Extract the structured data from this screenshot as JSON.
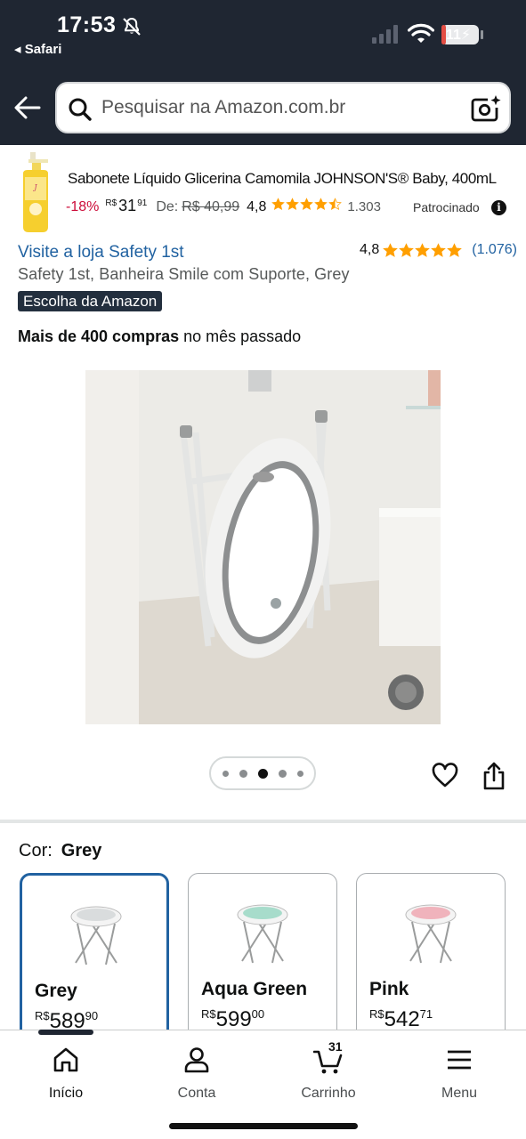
{
  "status_bar": {
    "time": "17:53",
    "back_app": "◂ Safari",
    "battery": "11",
    "battery_level": 0.11,
    "icons": [
      "bell-slash-icon",
      "cellular-signal-icon",
      "wifi-icon",
      "battery-icon"
    ]
  },
  "header": {
    "search_placeholder": "Pesquisar na Amazon.com.br",
    "icons": [
      "back-arrow-icon",
      "search-icon",
      "camera-search-icon"
    ]
  },
  "sponsored_ad": {
    "title": "Sabonete Líquido Glicerina Camomila JOHNSON'S® Baby, 400mL",
    "discount": "-18%",
    "currency": "R$",
    "price_whole": "31",
    "price_cents": "91",
    "old_label": "De:",
    "old_price": "R$ 40,99",
    "rating": "4,8",
    "rating_count": "1.303",
    "sponsored_label": "Patrocinado",
    "info_icon": "i",
    "stars": 4.5
  },
  "product": {
    "store_link": "Visite a loja Safety 1st",
    "rating": "4,8",
    "rating_count": "(1.076)",
    "stars": 5,
    "title": "Safety 1st, Banheira Smile com Suporte, Grey",
    "badge": "Escolha da Amazon",
    "purchases_bold": "Mais de 400 compras",
    "purchases_rest": " no mês passado",
    "image_dots": 5,
    "active_dot": 3
  },
  "color_selector": {
    "label": "Cor:",
    "selected": "Grey",
    "options": [
      {
        "name": "Grey",
        "currency": "R$",
        "price": "589",
        "cents": "90",
        "tint": "#d9dcdd"
      },
      {
        "name": "Aqua Green",
        "currency": "R$",
        "price": "599",
        "cents": "00",
        "tint": "#a7dccb"
      },
      {
        "name": "Pink",
        "currency": "R$",
        "price": "542",
        "cents": "71",
        "tint": "#f0b3bc"
      }
    ]
  },
  "bottom_nav": {
    "items": [
      {
        "label": "Início",
        "icon": "home-icon",
        "active": true
      },
      {
        "label": "Conta",
        "icon": "account-icon",
        "active": false
      },
      {
        "label": "Carrinho",
        "icon": "cart-icon",
        "active": false
      },
      {
        "label": "Menu",
        "icon": "menu-icon",
        "active": false
      }
    ],
    "cart_count": "31"
  },
  "colors": {
    "header_bg": "#1f2632",
    "link": "#2162a1",
    "star": "#ff9f00",
    "discount": "#cc0c39",
    "selected_border": "#2162a1"
  }
}
